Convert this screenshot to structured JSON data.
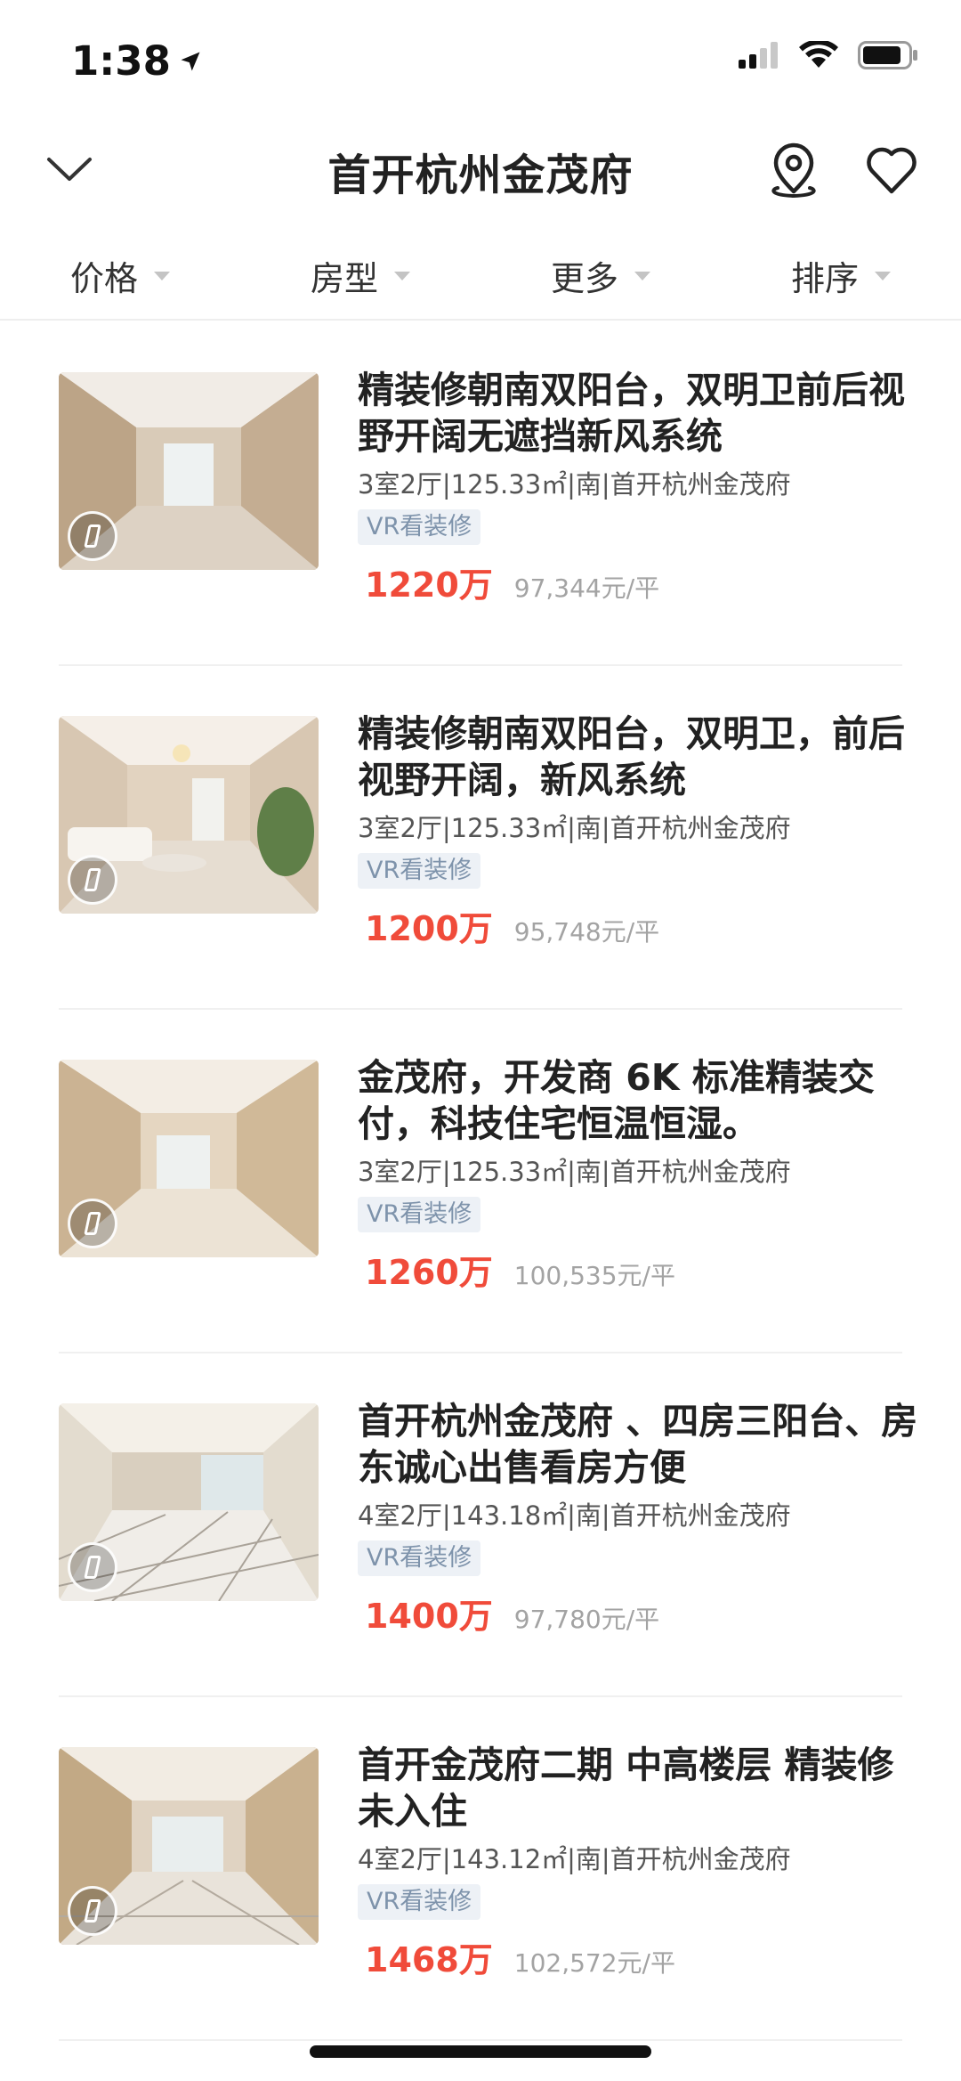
{
  "status": {
    "time": "1:38"
  },
  "header": {
    "title": "首开杭州金茂府"
  },
  "filters": [
    {
      "label": "价格"
    },
    {
      "label": "房型"
    },
    {
      "label": "更多"
    },
    {
      "label": "排序"
    }
  ],
  "listings": [
    {
      "title": "精装修朝南双阳台，双明卫前后视野开阔无遮挡新风系统",
      "meta": "3室2厅|125.33㎡|南|首开杭州金茂府",
      "tag": "VR看装修",
      "price": "1220万",
      "unit_price": "97,344元/平"
    },
    {
      "title": "精装修朝南双阳台，双明卫，前后视野开阔，新风系统",
      "meta": "3室2厅|125.33㎡|南|首开杭州金茂府",
      "tag": "VR看装修",
      "price": "1200万",
      "unit_price": "95,748元/平"
    },
    {
      "title": "金茂府，开发商 6K 标准精装交付，科技住宅恒温恒湿。",
      "meta": "3室2厅|125.33㎡|南|首开杭州金茂府",
      "tag": "VR看装修",
      "price": "1260万",
      "unit_price": "100,535元/平"
    },
    {
      "title": "首开杭州金茂府 、四房三阳台、房东诚心出售看房方便",
      "meta": "4室2厅|143.18㎡|南|首开杭州金茂府",
      "tag": "VR看装修",
      "price": "1400万",
      "unit_price": "97,780元/平"
    },
    {
      "title": "首开金茂府二期  中高楼层  精装修 未入住",
      "meta": "4室2厅|143.12㎡|南|首开杭州金茂府",
      "tag": "VR看装修",
      "price": "1468万",
      "unit_price": "102,572元/平"
    }
  ],
  "colors": {
    "price": "#f04b3a",
    "tag_bg": "#edf1f6",
    "tag_text": "#7e93ab"
  }
}
